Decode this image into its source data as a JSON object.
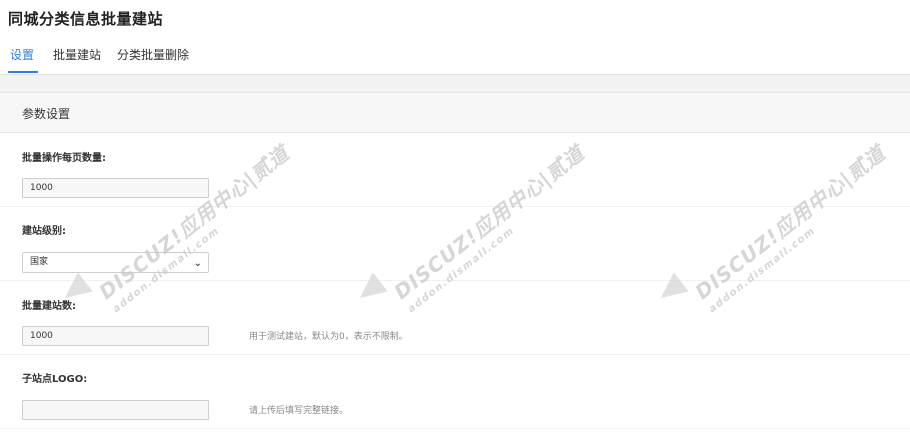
{
  "page": {
    "title": "同城分类信息批量建站"
  },
  "tabs": [
    {
      "label": "设置",
      "active": true
    },
    {
      "label": "批量建站",
      "active": false
    },
    {
      "label": "分类批量删除",
      "active": false
    }
  ],
  "panel": {
    "title": "参数设置"
  },
  "fields": {
    "per_page": {
      "label": "批量操作每页数量:",
      "value": "1000"
    },
    "site_level": {
      "label": "建站级别:",
      "selected": "国家"
    },
    "site_count": {
      "label": "批量建站数:",
      "value": "1000",
      "hint": "用于测试建站，默认为0，表示不限制。"
    },
    "logo": {
      "label": "子站点LOGO:",
      "value": "",
      "hint": "请上传后填写完整链接。"
    }
  },
  "watermark": {
    "text": "DISCUZ!应用中心|贰道",
    "sub": "addon.dismall.com"
  },
  "colors": {
    "accent": "#2f7ee0"
  }
}
